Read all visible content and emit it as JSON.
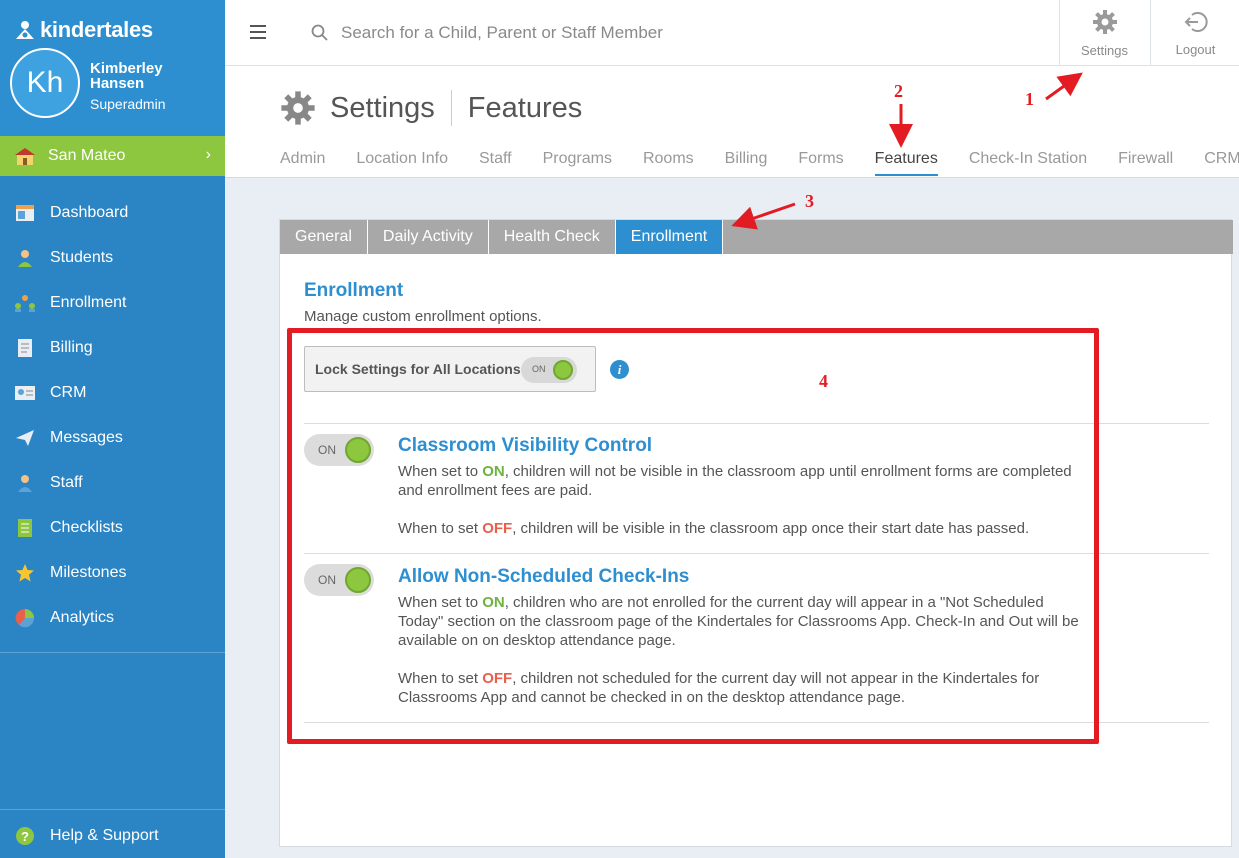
{
  "brand": {
    "name": "kindertales"
  },
  "profile": {
    "initials": "Kh",
    "name": "Kimberley Hansen",
    "role": "Superadmin"
  },
  "location": {
    "name": "San Mateo"
  },
  "nav": [
    {
      "label": "Dashboard",
      "icon": "dashboard-icon"
    },
    {
      "label": "Students",
      "icon": "student-icon"
    },
    {
      "label": "Enrollment",
      "icon": "enrollment-icon"
    },
    {
      "label": "Billing",
      "icon": "billing-icon"
    },
    {
      "label": "CRM",
      "icon": "crm-icon"
    },
    {
      "label": "Messages",
      "icon": "paper-plane-icon"
    },
    {
      "label": "Staff",
      "icon": "staff-icon"
    },
    {
      "label": "Checklists",
      "icon": "checklist-icon"
    },
    {
      "label": "Milestones",
      "icon": "star-icon"
    },
    {
      "label": "Analytics",
      "icon": "pie-chart-icon"
    }
  ],
  "help": {
    "label": "Help & Support"
  },
  "search": {
    "placeholder": "Search for a Child, Parent or Staff Member"
  },
  "top_buttons": {
    "settings": "Settings",
    "logout": "Logout"
  },
  "header": {
    "title": "Settings",
    "subtitle": "Features",
    "tabs": [
      "Admin",
      "Location Info",
      "Staff",
      "Programs",
      "Rooms",
      "Billing",
      "Forms",
      "Features",
      "Check-In Station",
      "Firewall",
      "CRM"
    ],
    "active_tab": "Features"
  },
  "subtabs": {
    "items": [
      "General",
      "Daily Activity",
      "Health Check",
      "Enrollment"
    ],
    "active": "Enrollment"
  },
  "section": {
    "title": "Enrollment",
    "description": "Manage custom enrollment options."
  },
  "lock": {
    "label": "Lock Settings for All Locations",
    "state": "ON"
  },
  "features": [
    {
      "title": "Classroom Visibility Control",
      "state": "ON",
      "on_prefix": "When set to ",
      "on_word": "ON",
      "on_text": ", children will not be visible in the classroom app until enrollment forms are completed and enrollment fees are paid.",
      "off_prefix": "When to set ",
      "off_word": "OFF",
      "off_text": ", children will be visible in the classroom app once their start date has passed."
    },
    {
      "title": "Allow Non-Scheduled Check-Ins",
      "state": "ON",
      "on_prefix": "When set to ",
      "on_word": "ON",
      "on_text": ", children who are not enrolled for the current day will appear in a \"Not Scheduled Today\" section on the classroom page of the Kindertales for Classrooms App. Check-In and Out will be available on on desktop attendance page.",
      "off_prefix": "When to set ",
      "off_word": "OFF",
      "off_text": ", children not scheduled for the current day will not appear in the Kindertales for Classrooms App and cannot be checked in on the desktop attendance page."
    }
  ],
  "annotations": {
    "n1": "1",
    "n2": "2",
    "n3": "3",
    "n4": "4"
  },
  "colors": {
    "sidebar": "#2b84c4",
    "accent": "#2d8fd0",
    "location_bar": "#8dc63f",
    "annotation": "#e31b23"
  }
}
